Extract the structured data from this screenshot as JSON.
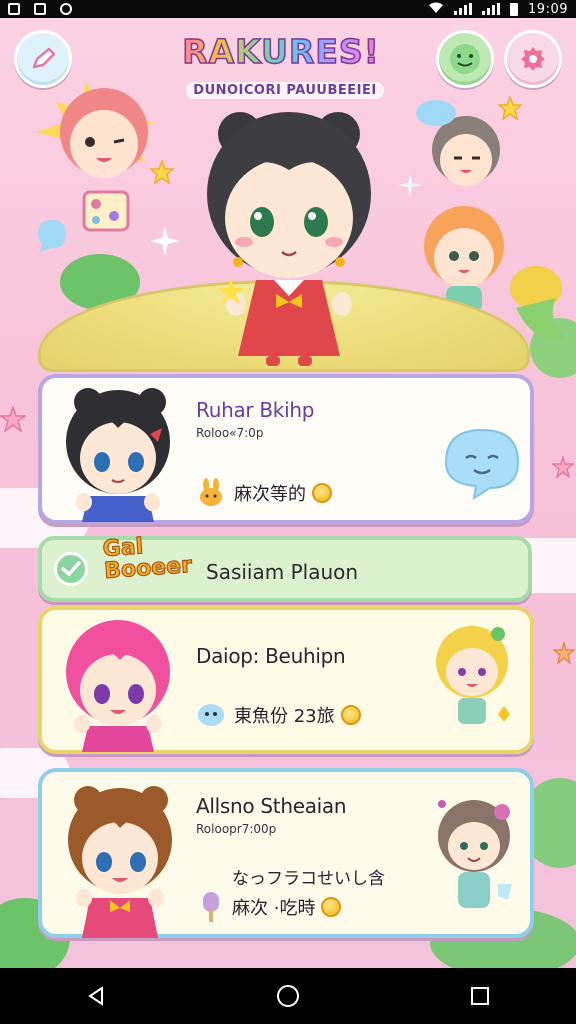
{
  "status_bar": {
    "time": "19:09"
  },
  "header": {
    "title": "RAKURES!",
    "subtitle": "DUNOICORI PAUUBEEIEI"
  },
  "cards": [
    {
      "name": "Ruhar Bkihp",
      "sub": "Roloo«7:0p",
      "line": "麻次等的"
    },
    {
      "name": "Daiop: Beuhipn",
      "line": "東魚份 23旅"
    },
    {
      "name": "Allsno Stheaian",
      "sub": "Roloopr7:00p",
      "line": "なっフラコせいし含",
      "line2": "麻次 ·吃時"
    }
  ],
  "pill": {
    "badge": "Gal Booeer",
    "text": "Sasiiam Plauon"
  },
  "colors": {
    "background": "#f7c9dc",
    "card_border_1": "#b7a6e6",
    "card_border_2": "#e8d46a",
    "card_border_3": "#8fcfe8",
    "pill": "#dcf2cf"
  }
}
